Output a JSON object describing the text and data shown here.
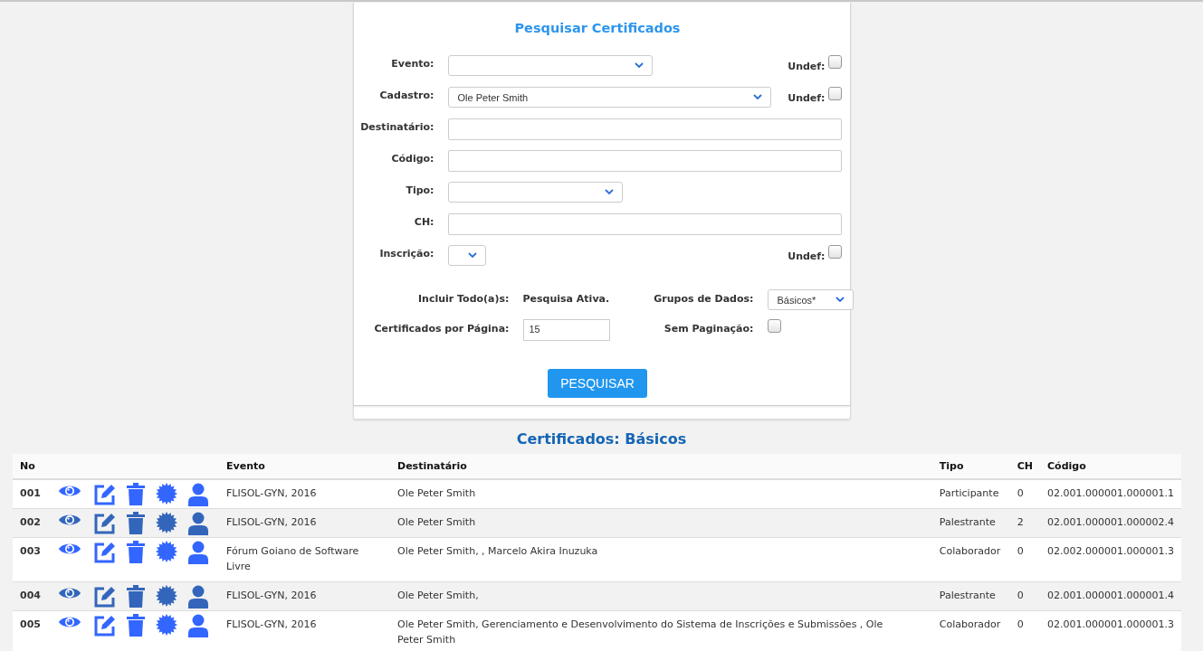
{
  "search_form": {
    "title": "Pesquisar Certificados",
    "fields": [
      {
        "kind": "select",
        "label": "Evento:",
        "undef": {
          "label": "Undef:",
          "checked": false
        }
      },
      {
        "kind": "select",
        "label": "Cadastro:",
        "value": "Ole Peter Smith",
        "undef": {
          "label": "Undef:",
          "checked": false
        }
      },
      {
        "kind": "text",
        "label": "Destinatário:"
      },
      {
        "kind": "text",
        "label": "Código:"
      },
      {
        "kind": "select",
        "label": "Tipo:"
      },
      {
        "kind": "text",
        "label": "CH:"
      },
      {
        "kind": "select",
        "label": "Inscrição:",
        "undef": {
          "label": "Undef:",
          "checked": false
        }
      }
    ],
    "include_label": "Incluir Todo(a)s:",
    "include_value": "Pesquisa Ativa.",
    "groups_label": "Grupos de Dados:",
    "groups_value": "Básicos*",
    "per_page_label": "Certificados por Página:",
    "per_page_value": "15",
    "no_pagination": {
      "label": "Sem Paginação:",
      "checked": false
    },
    "search_button": "PESQUISAR"
  },
  "results": {
    "title": "Certificados: Básicos",
    "columns": [
      "No",
      "Evento",
      "Destinatário",
      "Tipo",
      "CH",
      "Código"
    ],
    "rows": [
      {
        "no": "001",
        "evento": "FLISOL-GYN, 2016",
        "destinatario": "Ole Peter Smith",
        "tipo": "Participante",
        "ch": "0",
        "codigo": "02.001.000001.000001.1"
      },
      {
        "no": "002",
        "evento": "FLISOL-GYN, 2016",
        "destinatario": "Ole Peter Smith",
        "tipo": "Palestrante",
        "ch": "2",
        "codigo": "02.001.000001.000002.4"
      },
      {
        "no": "003",
        "evento": "Fórum Goiano de Software Livre",
        "destinatario": "Ole Peter Smith, , Marcelo Akira Inuzuka",
        "tipo": "Colaborador",
        "ch": "0",
        "codigo": "02.002.000001.000001.3"
      },
      {
        "no": "004",
        "evento": "FLISOL-GYN, 2016",
        "destinatario": "Ole Peter Smith,",
        "tipo": "Palestrante",
        "ch": "0",
        "codigo": "02.001.000001.000001.4"
      },
      {
        "no": "005",
        "evento": "FLISOL-GYN, 2016",
        "destinatario": "Ole Peter Smith, Gerenciamento e Desenvolvimento do Sistema de Inscrições e Submissões , Ole Peter Smith",
        "tipo": "Colaborador",
        "ch": "0",
        "codigo": "02.001.000001.000001.3"
      }
    ]
  }
}
